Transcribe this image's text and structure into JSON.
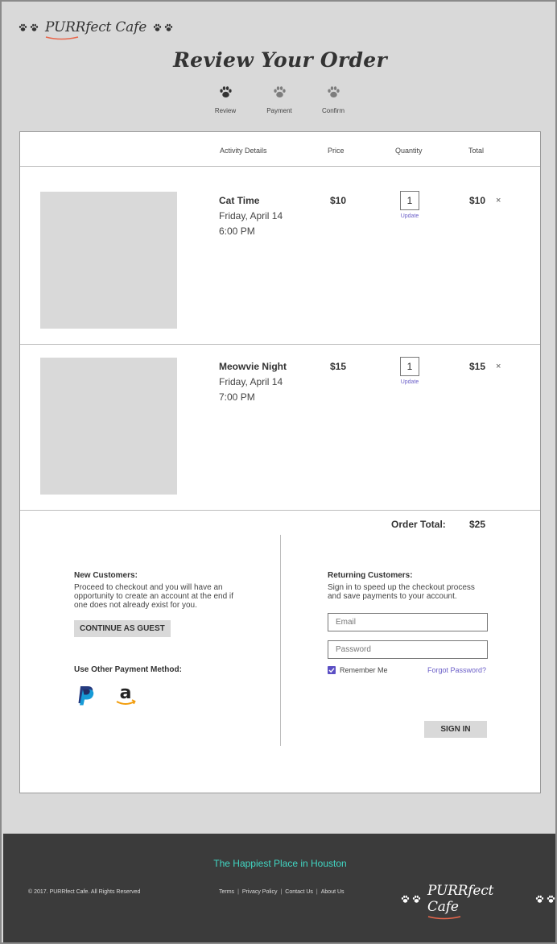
{
  "brand": {
    "name": "PURRfect Cafe",
    "icon": "paw-icon"
  },
  "page": {
    "title": "Review Your Order"
  },
  "steps": [
    {
      "label": "Review",
      "active": true
    },
    {
      "label": "Payment",
      "active": false
    },
    {
      "label": "Confirm",
      "active": false
    }
  ],
  "table": {
    "headers": {
      "activity": "Activity Details",
      "price": "Price",
      "quantity": "Quantity",
      "total": "Total"
    },
    "items": [
      {
        "name": "Cat Time",
        "date": "Friday, April 14",
        "time": "6:00 PM",
        "price": "$10",
        "quantity": "1",
        "update": "Update",
        "total": "$10",
        "remove": "×"
      },
      {
        "name": "Meowvie Night",
        "date": "Friday, April 14",
        "time": "7:00 PM",
        "price": "$15",
        "quantity": "1",
        "update": "Update",
        "total": "$15",
        "remove": "×"
      }
    ],
    "order_total_label": "Order Total:",
    "order_total_value": "$25"
  },
  "new_customers": {
    "heading": "New Customers:",
    "text": "Proceed to checkout and you will have an opportunity to create an account at the end if one does not already exist for you.",
    "button": "CONTINUE AS GUEST",
    "other_payment_heading": "Use Other Payment Method:",
    "payment_icons": [
      "paypal-icon",
      "amazon-icon"
    ]
  },
  "returning_customers": {
    "heading": "Returning Customers:",
    "text": "Sign in to speed up the checkout process and save payments to your account.",
    "email_placeholder": "Email",
    "password_placeholder": "Password",
    "remember_label": "Remember Me",
    "remember_checked": true,
    "forgot_link": "Forgot Password?",
    "button": "SIGN IN"
  },
  "footer": {
    "tagline": "The Happiest Place in Houston",
    "copyright": "© 2017. PURRfect Cafe. All Rights Reserved",
    "links": [
      "Terms",
      "Privacy Policy",
      "Contact Us",
      "About Us"
    ]
  },
  "colors": {
    "accent": "#5b4fc4",
    "link": "#6b5fc8",
    "footer_bg": "#3b3b3b",
    "tagline": "#41d6c3",
    "swoosh": "#e8674c"
  }
}
